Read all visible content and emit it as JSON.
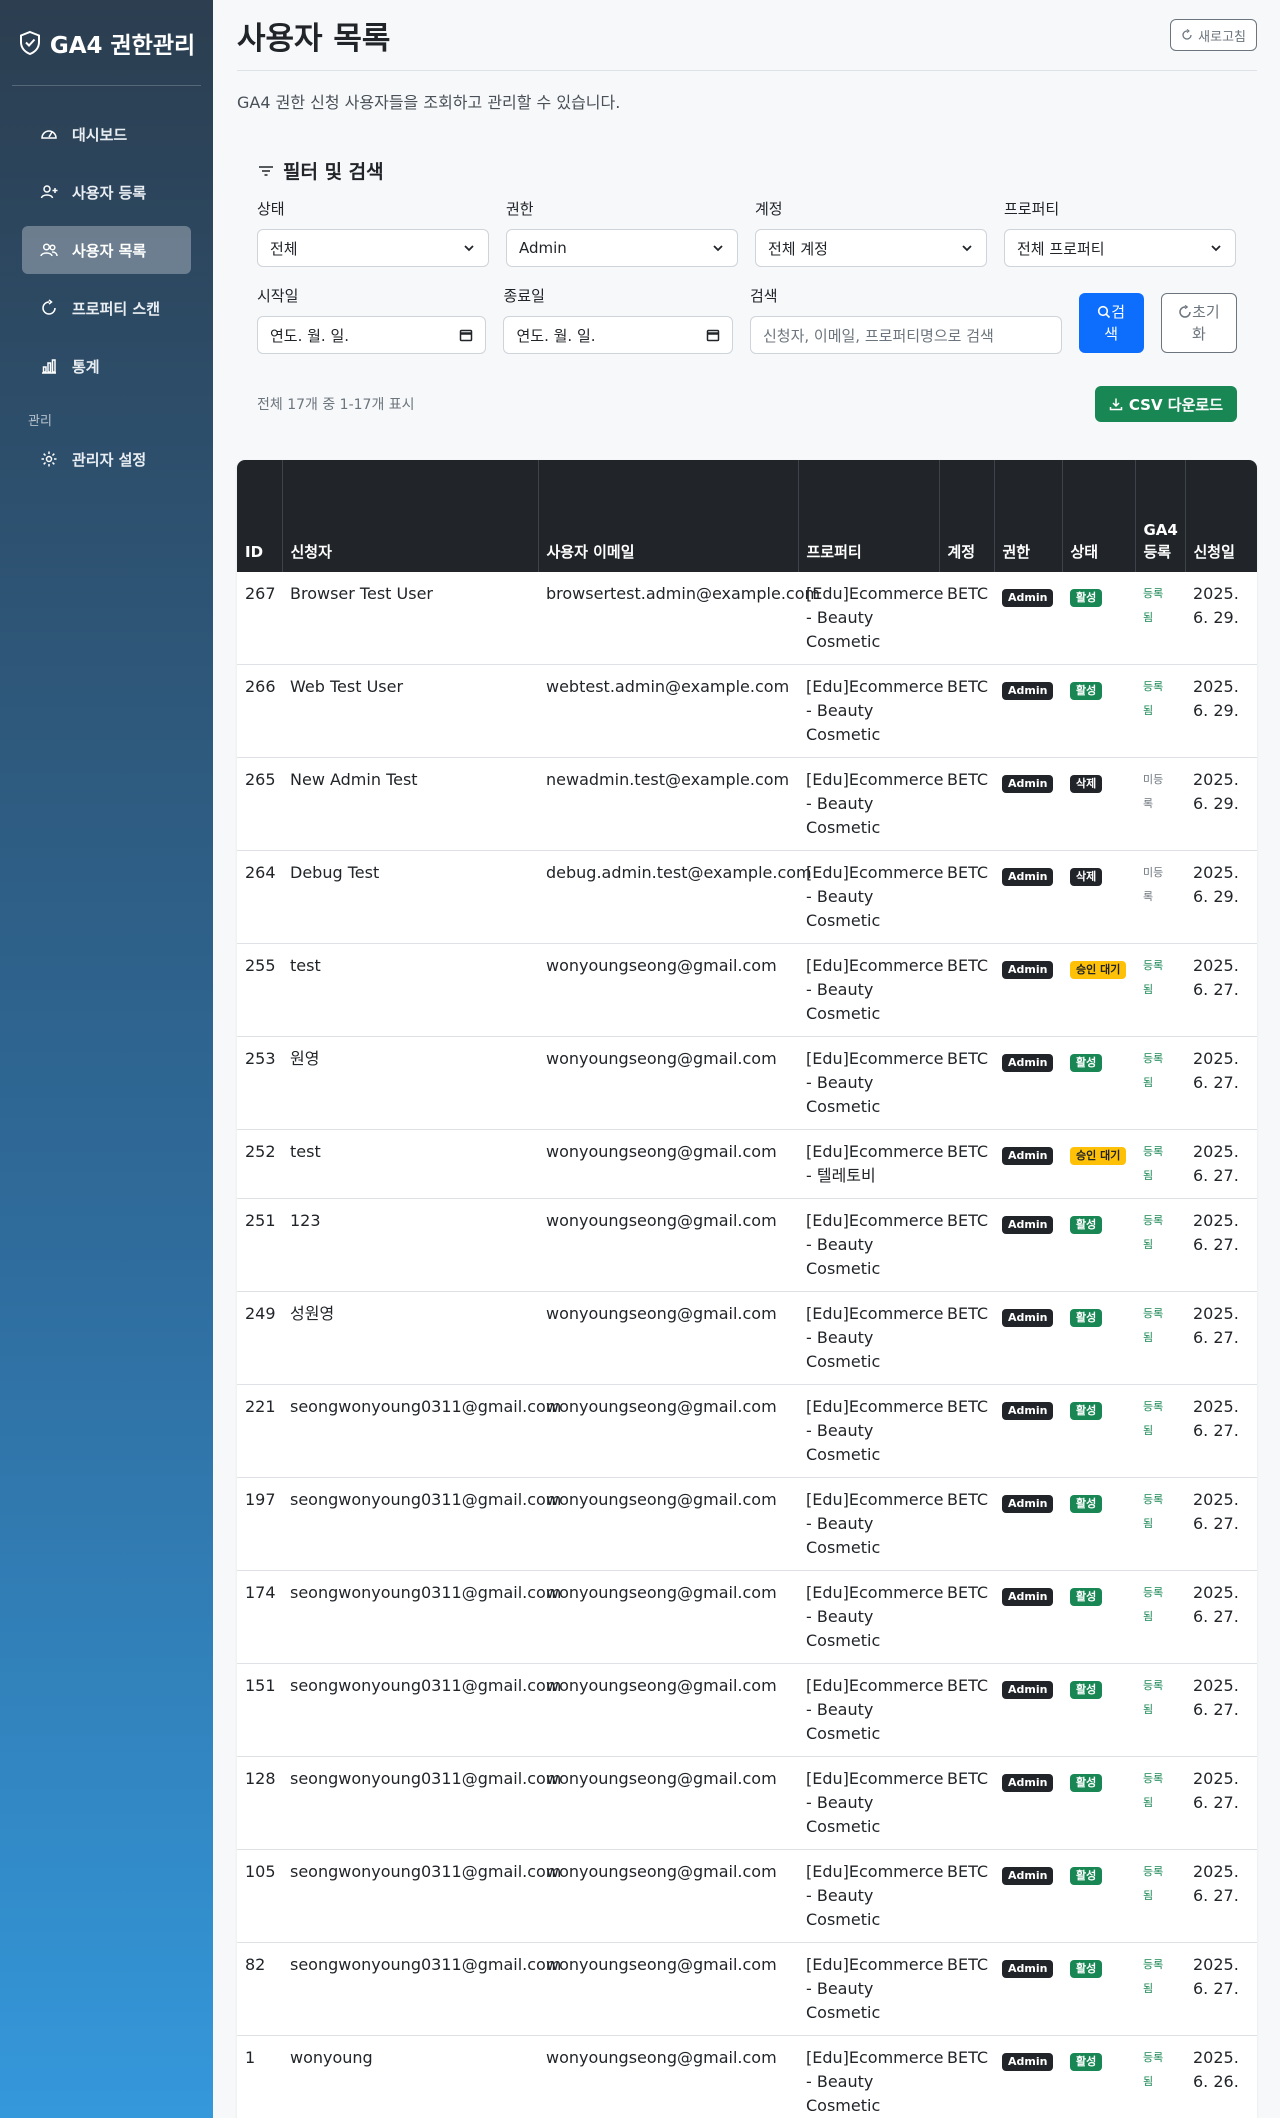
{
  "sidebar": {
    "brand": "GA4 권한관리",
    "items": [
      {
        "label": "대시보드",
        "icon": "speedometer-icon"
      },
      {
        "label": "사용자 등록",
        "icon": "user-plus-icon"
      },
      {
        "label": "사용자 목록",
        "icon": "users-icon"
      },
      {
        "label": "프로퍼티 스캔",
        "icon": "refresh-icon"
      },
      {
        "label": "통계",
        "icon": "bar-chart-icon"
      }
    ],
    "section_label": "관리",
    "admin_item": "관리자 설정"
  },
  "header": {
    "title": "사용자 목록",
    "refresh_label": "새로고침",
    "description": "GA4 권한 신청 사용자들을 조회하고 관리할 수 있습니다."
  },
  "filters": {
    "title": "필터 및 검색",
    "status": {
      "label": "상태",
      "value": "전체"
    },
    "permission": {
      "label": "권한",
      "value": "Admin"
    },
    "account": {
      "label": "계정",
      "value": "전체 계정"
    },
    "property": {
      "label": "프로퍼티",
      "value": "전체 프로퍼티"
    },
    "start_date": {
      "label": "시작일",
      "value": "연도. 월. 일."
    },
    "end_date": {
      "label": "종료일",
      "value": "연도. 월. 일."
    },
    "search": {
      "label": "검색",
      "placeholder": "신청자, 이메일, 프로퍼티명으로 검색"
    },
    "search_button": [
      "검",
      "색"
    ],
    "reset_button": [
      "초기",
      "화"
    ]
  },
  "results": {
    "count_text": "전체 17개 중 1-17개 표시",
    "csv_label": "CSV 다운로드"
  },
  "table": {
    "headers": {
      "id": "ID",
      "applicant": "신청자",
      "email": "사용자 이메일",
      "property": "프로퍼티",
      "account": "계정",
      "permission": "권한",
      "status": "상태",
      "ga4_line1": "GA4",
      "ga4_line2": "등록",
      "date": "신청일"
    },
    "rows": [
      {
        "id": "267",
        "applicant": "Browser Test User",
        "email": "browsertest.admin@example.com",
        "property": [
          "[Edu]Ecommerce",
          "- Beauty",
          "Cosmetic"
        ],
        "account": "BETC",
        "permission": "Admin",
        "status": "활성",
        "status_type": "active",
        "ga4": [
          "등록",
          "됨"
        ],
        "ga4_type": "reg",
        "date": [
          "2025.",
          "6. 29."
        ]
      },
      {
        "id": "266",
        "applicant": "Web Test User",
        "email": "webtest.admin@example.com",
        "property": [
          "[Edu]Ecommerce",
          "- Beauty",
          "Cosmetic"
        ],
        "account": "BETC",
        "permission": "Admin",
        "status": "활성",
        "status_type": "active",
        "ga4": [
          "등록",
          "됨"
        ],
        "ga4_type": "reg",
        "date": [
          "2025.",
          "6. 29."
        ]
      },
      {
        "id": "265",
        "applicant": "New Admin Test",
        "email": "newadmin.test@example.com",
        "property": [
          "[Edu]Ecommerce",
          "- Beauty",
          "Cosmetic"
        ],
        "account": "BETC",
        "permission": "Admin",
        "status": "삭제",
        "status_type": "deleted",
        "ga4": [
          "미등",
          "록"
        ],
        "ga4_type": "unreg",
        "date": [
          "2025.",
          "6. 29."
        ]
      },
      {
        "id": "264",
        "applicant": "Debug Test",
        "email": "debug.admin.test@example.com",
        "property": [
          "[Edu]Ecommerce",
          "- Beauty",
          "Cosmetic"
        ],
        "account": "BETC",
        "permission": "Admin",
        "status": "삭제",
        "status_type": "deleted",
        "ga4": [
          "미등",
          "록"
        ],
        "ga4_type": "unreg",
        "date": [
          "2025.",
          "6. 29."
        ]
      },
      {
        "id": "255",
        "applicant": "test",
        "email": "wonyoungseong@gmail.com",
        "property": [
          "[Edu]Ecommerce",
          "- Beauty",
          "Cosmetic"
        ],
        "account": "BETC",
        "permission": "Admin",
        "status": "승인 대기",
        "status_type": "pending",
        "ga4": [
          "등록",
          "됨"
        ],
        "ga4_type": "reg",
        "date": [
          "2025.",
          "6. 27."
        ]
      },
      {
        "id": "253",
        "applicant": "원영",
        "email": "wonyoungseong@gmail.com",
        "property": [
          "[Edu]Ecommerce",
          "- Beauty",
          "Cosmetic"
        ],
        "account": "BETC",
        "permission": "Admin",
        "status": "활성",
        "status_type": "active",
        "ga4": [
          "등록",
          "됨"
        ],
        "ga4_type": "reg",
        "date": [
          "2025.",
          "6. 27."
        ]
      },
      {
        "id": "252",
        "applicant": "test",
        "email": "wonyoungseong@gmail.com",
        "property": [
          "[Edu]Ecommerce",
          "- 텔레토비"
        ],
        "account": "BETC",
        "permission": "Admin",
        "status": "승인 대기",
        "status_type": "pending",
        "ga4": [
          "등록",
          "됨"
        ],
        "ga4_type": "reg",
        "date": [
          "2025.",
          "6. 27."
        ]
      },
      {
        "id": "251",
        "applicant": "123",
        "email": "wonyoungseong@gmail.com",
        "property": [
          "[Edu]Ecommerce",
          "- Beauty",
          "Cosmetic"
        ],
        "account": "BETC",
        "permission": "Admin",
        "status": "활성",
        "status_type": "active",
        "ga4": [
          "등록",
          "됨"
        ],
        "ga4_type": "reg",
        "date": [
          "2025.",
          "6. 27."
        ]
      },
      {
        "id": "249",
        "applicant": "성원영",
        "email": "wonyoungseong@gmail.com",
        "property": [
          "[Edu]Ecommerce",
          "- Beauty",
          "Cosmetic"
        ],
        "account": "BETC",
        "permission": "Admin",
        "status": "활성",
        "status_type": "active",
        "ga4": [
          "등록",
          "됨"
        ],
        "ga4_type": "reg",
        "date": [
          "2025.",
          "6. 27."
        ]
      },
      {
        "id": "221",
        "applicant": "seongwonyoung0311@gmail.com",
        "email": "wonyoungseong@gmail.com",
        "property": [
          "[Edu]Ecommerce",
          "- Beauty",
          "Cosmetic"
        ],
        "account": "BETC",
        "permission": "Admin",
        "status": "활성",
        "status_type": "active",
        "ga4": [
          "등록",
          "됨"
        ],
        "ga4_type": "reg",
        "date": [
          "2025.",
          "6. 27."
        ]
      },
      {
        "id": "197",
        "applicant": "seongwonyoung0311@gmail.com",
        "email": "wonyoungseong@gmail.com",
        "property": [
          "[Edu]Ecommerce",
          "- Beauty",
          "Cosmetic"
        ],
        "account": "BETC",
        "permission": "Admin",
        "status": "활성",
        "status_type": "active",
        "ga4": [
          "등록",
          "됨"
        ],
        "ga4_type": "reg",
        "date": [
          "2025.",
          "6. 27."
        ]
      },
      {
        "id": "174",
        "applicant": "seongwonyoung0311@gmail.com",
        "email": "wonyoungseong@gmail.com",
        "property": [
          "[Edu]Ecommerce",
          "- Beauty",
          "Cosmetic"
        ],
        "account": "BETC",
        "permission": "Admin",
        "status": "활성",
        "status_type": "active",
        "ga4": [
          "등록",
          "됨"
        ],
        "ga4_type": "reg",
        "date": [
          "2025.",
          "6. 27."
        ]
      },
      {
        "id": "151",
        "applicant": "seongwonyoung0311@gmail.com",
        "email": "wonyoungseong@gmail.com",
        "property": [
          "[Edu]Ecommerce",
          "- Beauty",
          "Cosmetic"
        ],
        "account": "BETC",
        "permission": "Admin",
        "status": "활성",
        "status_type": "active",
        "ga4": [
          "등록",
          "됨"
        ],
        "ga4_type": "reg",
        "date": [
          "2025.",
          "6. 27."
        ]
      },
      {
        "id": "128",
        "applicant": "seongwonyoung0311@gmail.com",
        "email": "wonyoungseong@gmail.com",
        "property": [
          "[Edu]Ecommerce",
          "- Beauty",
          "Cosmetic"
        ],
        "account": "BETC",
        "permission": "Admin",
        "status": "활성",
        "status_type": "active",
        "ga4": [
          "등록",
          "됨"
        ],
        "ga4_type": "reg",
        "date": [
          "2025.",
          "6. 27."
        ]
      },
      {
        "id": "105",
        "applicant": "seongwonyoung0311@gmail.com",
        "email": "wonyoungseong@gmail.com",
        "property": [
          "[Edu]Ecommerce",
          "- Beauty",
          "Cosmetic"
        ],
        "account": "BETC",
        "permission": "Admin",
        "status": "활성",
        "status_type": "active",
        "ga4": [
          "등록",
          "됨"
        ],
        "ga4_type": "reg",
        "date": [
          "2025.",
          "6. 27."
        ]
      },
      {
        "id": "82",
        "applicant": "seongwonyoung0311@gmail.com",
        "email": "wonyoungseong@gmail.com",
        "property": [
          "[Edu]Ecommerce",
          "- Beauty",
          "Cosmetic"
        ],
        "account": "BETC",
        "permission": "Admin",
        "status": "활성",
        "status_type": "active",
        "ga4": [
          "등록",
          "됨"
        ],
        "ga4_type": "reg",
        "date": [
          "2025.",
          "6. 27."
        ]
      },
      {
        "id": "1",
        "applicant": "wonyoung",
        "email": "wonyoungseong@gmail.com",
        "property": [
          "[Edu]Ecommerce",
          "- Beauty",
          "Cosmetic"
        ],
        "account": "BETC",
        "permission": "Admin",
        "status": "활성",
        "status_type": "active",
        "ga4": [
          "등록",
          "됨"
        ],
        "ga4_type": "reg",
        "date": [
          "2025.",
          "6. 26."
        ]
      }
    ]
  }
}
